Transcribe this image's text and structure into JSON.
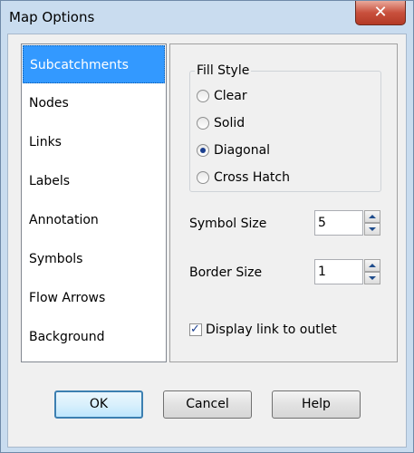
{
  "window": {
    "title": "Map Options",
    "close_glyph": "✕"
  },
  "nav": {
    "items": [
      {
        "label": "Subcatchments",
        "selected": true
      },
      {
        "label": "Nodes"
      },
      {
        "label": "Links"
      },
      {
        "label": "Labels"
      },
      {
        "label": "Annotation"
      },
      {
        "label": "Symbols"
      },
      {
        "label": "Flow Arrows"
      },
      {
        "label": "Background"
      }
    ]
  },
  "fill_style": {
    "legend": "Fill Style",
    "options": [
      "Clear",
      "Solid",
      "Diagonal",
      "Cross Hatch"
    ],
    "selected": "Diagonal"
  },
  "symbol_size": {
    "label": "Symbol Size",
    "value": "5"
  },
  "border_size": {
    "label": "Border Size",
    "value": "1"
  },
  "display_link": {
    "label": "Display link to outlet",
    "checked": true,
    "check_glyph": "✓"
  },
  "buttons": {
    "ok": "OK",
    "cancel": "Cancel",
    "help": "Help"
  }
}
